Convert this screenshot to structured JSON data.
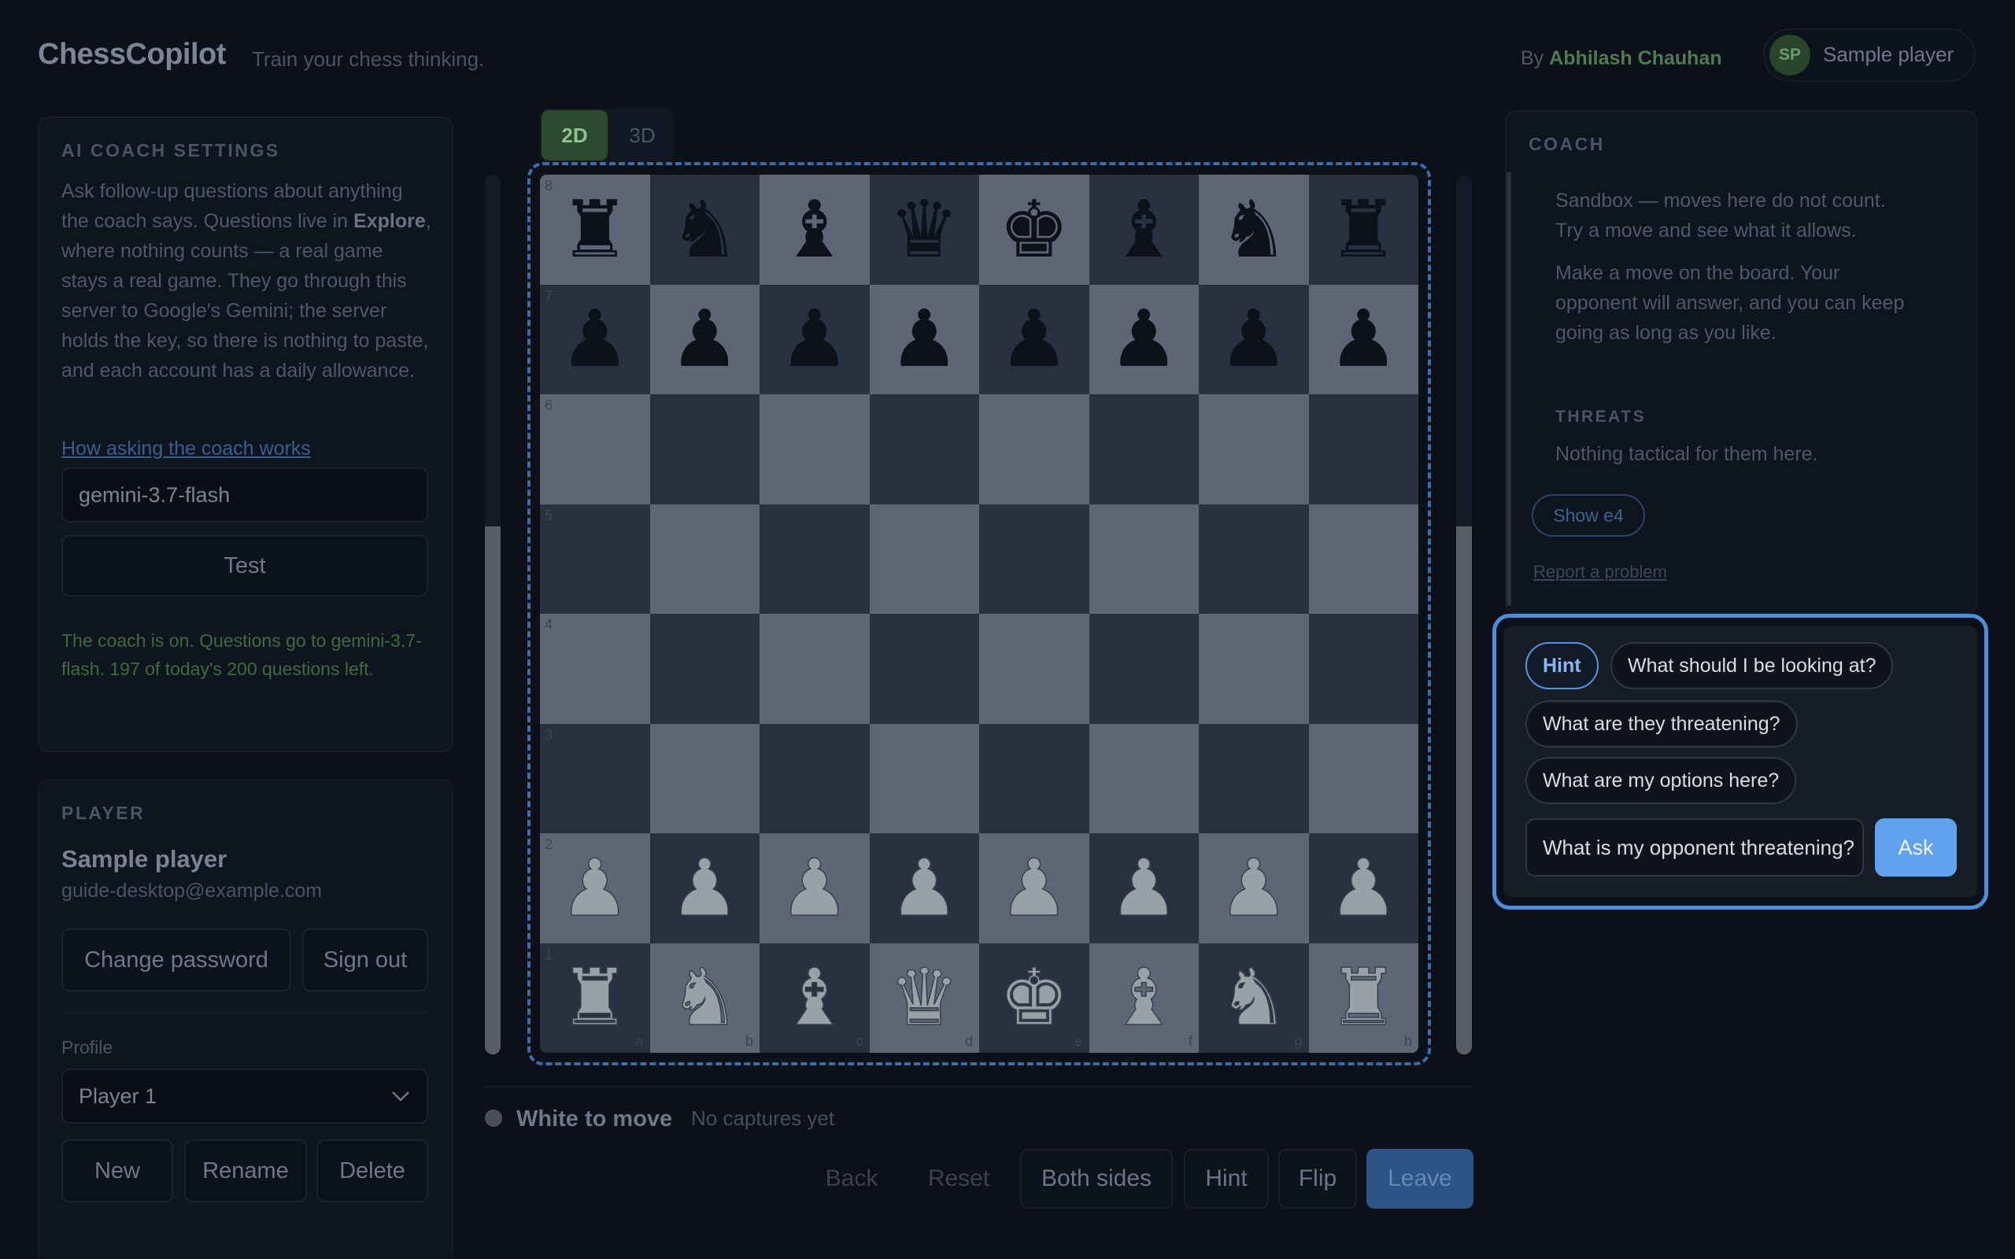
{
  "header": {
    "app_name": "ChessCopilot",
    "tagline": "Train your chess thinking.",
    "by_prefix": "By",
    "author": "Abhilash Chauhan",
    "avatar_initials": "SP",
    "user_name": "Sample player"
  },
  "settings": {
    "title": "AI COACH SETTINGS",
    "desc_1": "Ask follow-up questions about anything the coach says. Questions live in",
    "desc_bold": "Explore",
    "desc_2": ", where nothing counts — a real game stays a real game. They go through this server to Google's Gemini; the server holds the key, so there is nothing to paste, and each account has a daily allowance.",
    "help_link": "How asking the coach works",
    "model_value": "gemini-3.7-flash",
    "test_label": "Test",
    "status": "The coach is on. Questions go to gemini-3.7-flash. 197 of today's 200 questions left."
  },
  "player": {
    "title": "PLAYER",
    "name": "Sample player",
    "email": "guide-desktop@example.com",
    "change_password": "Change password",
    "sign_out": "Sign out",
    "profile_label": "Profile",
    "profile_selected": "Player 1",
    "new_label": "New",
    "rename_label": "Rename",
    "delete_label": "Delete"
  },
  "view_toggle": {
    "option_2d": "2D",
    "option_3d": "3D",
    "selected": "2D"
  },
  "board": {
    "files": [
      "a",
      "b",
      "c",
      "d",
      "e",
      "f",
      "g",
      "h"
    ],
    "ranks": [
      "8",
      "7",
      "6",
      "5",
      "4",
      "3",
      "2",
      "1"
    ],
    "position": [
      [
        "br",
        "bn",
        "bb",
        "bq",
        "bk",
        "bb",
        "bn",
        "br"
      ],
      [
        "bp",
        "bp",
        "bp",
        "bp",
        "bp",
        "bp",
        "bp",
        "bp"
      ],
      [
        "",
        "",
        "",
        "",
        "",
        "",
        "",
        ""
      ],
      [
        "",
        "",
        "",
        "",
        "",
        "",
        "",
        ""
      ],
      [
        "",
        "",
        "",
        "",
        "",
        "",
        "",
        ""
      ],
      [
        "",
        "",
        "",
        "",
        "",
        "",
        "",
        ""
      ],
      [
        "wp",
        "wp",
        "wp",
        "wp",
        "wp",
        "wp",
        "wp",
        "wp"
      ],
      [
        "wr",
        "wn",
        "wb",
        "wq",
        "wk",
        "wb",
        "wn",
        "wr"
      ]
    ],
    "eval_white_fraction": 0.6
  },
  "game_status": {
    "turn": "White to move",
    "captures": "No captures yet"
  },
  "controls": {
    "back": "Back",
    "reset": "Reset",
    "both_sides": "Both sides",
    "hint": "Hint",
    "flip": "Flip",
    "leave": "Leave"
  },
  "coach": {
    "title": "COACH",
    "line_1": "Sandbox — moves here do not count. Try a move and see what it allows.",
    "line_2": "Make a move on the board. Your opponent will answer, and you can keep going as long as you like.",
    "threats_title": "THREATS",
    "threats_text": "Nothing tactical for them here.",
    "show_button": "Show e4",
    "report_link": "Report a problem"
  },
  "ask": {
    "chips": [
      "Hint",
      "What should I be looking at?",
      "What are they threatening?",
      "What are my options here?"
    ],
    "input_value": "What is my opponent threatening?",
    "ask_button": "Ask"
  },
  "colors": {
    "accent": "#4a90e2",
    "ask_button": "#5fa3ee",
    "author": "#4f7a52",
    "status": "#3f6b3d"
  }
}
